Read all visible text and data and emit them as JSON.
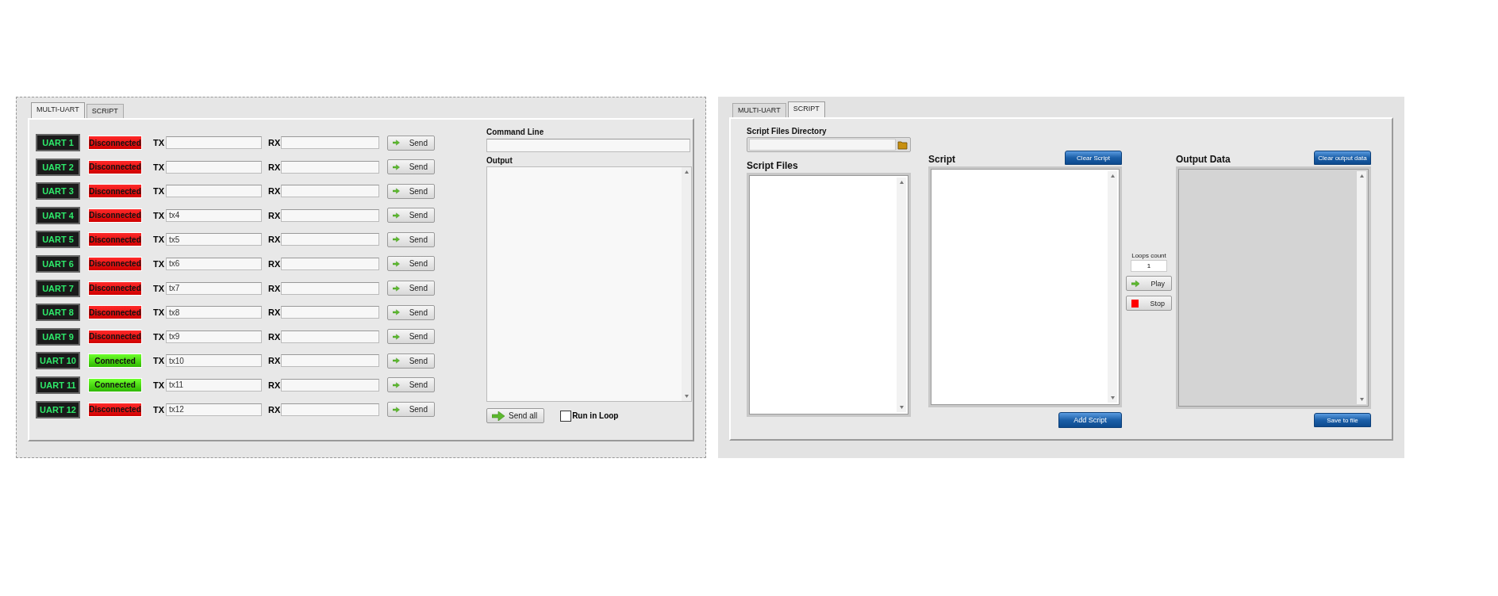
{
  "multi_uart": {
    "tabs": [
      {
        "label": "MULTI-UART",
        "selected": true
      },
      {
        "label": "SCRIPT",
        "selected": false
      }
    ],
    "channels": [
      {
        "name": "UART 1",
        "status": "Disconnected",
        "connected": false,
        "tx_label": "TX",
        "rx_label": "RX",
        "send": "Send"
      },
      {
        "name": "UART 2",
        "status": "Disconnected",
        "connected": false,
        "tx_label": "TX",
        "rx_label": "RX",
        "send": "Send"
      },
      {
        "name": "UART 3",
        "status": "Disconnected",
        "connected": false,
        "tx_label": "TX",
        "rx_label": "RX",
        "send": "Send"
      },
      {
        "name": "UART 4",
        "status": "Disconnected",
        "connected": false,
        "tx_label": "TX",
        "tx": "tx4",
        "rx_label": "RX",
        "send": "Send"
      },
      {
        "name": "UART 5",
        "status": "Disconnected",
        "connected": false,
        "tx_label": "TX",
        "tx": "tx5",
        "rx_label": "RX",
        "send": "Send"
      },
      {
        "name": "UART 6",
        "status": "Disconnected",
        "connected": false,
        "tx_label": "TX",
        "tx": "tx6",
        "rx_label": "RX",
        "send": "Send"
      },
      {
        "name": "UART 7",
        "status": "Disconnected",
        "connected": false,
        "tx_label": "TX",
        "tx": "tx7",
        "rx_label": "RX",
        "send": "Send"
      },
      {
        "name": "UART 8",
        "status": "Disconnected",
        "connected": false,
        "tx_label": "TX",
        "tx": "tx8",
        "rx_label": "RX",
        "send": "Send"
      },
      {
        "name": "UART 9",
        "status": "Disconnected",
        "connected": false,
        "tx_label": "TX",
        "tx": "tx9",
        "rx_label": "RX",
        "send": "Send"
      },
      {
        "name": "UART 10",
        "status": "Connected",
        "connected": true,
        "tx_label": "TX",
        "tx": "tx10",
        "rx_label": "RX",
        "send": "Send"
      },
      {
        "name": "UART 11",
        "status": "Connected",
        "connected": true,
        "tx_label": "TX",
        "tx": "tx11",
        "rx_label": "RX",
        "send": "Send"
      },
      {
        "name": "UART 12",
        "status": "Disconnected",
        "connected": false,
        "tx_label": "TX",
        "tx": "tx12",
        "rx_label": "RX",
        "send": "Send"
      }
    ],
    "command_line": {
      "label": "Command Line"
    },
    "output": {
      "label": "Output"
    },
    "send_all": "Send all",
    "run_in_loop": {
      "label": "Run in Loop",
      "checked": false
    }
  },
  "script": {
    "tabs": [
      {
        "label": "MULTI-UART",
        "selected": false
      },
      {
        "label": "SCRIPT",
        "selected": true
      }
    ],
    "directory": {
      "label": "Script Files Directory"
    },
    "script_files": {
      "label": "Script Files"
    },
    "script": {
      "label": "Script",
      "clear_button": "Clear Script",
      "add_button": "Add Script"
    },
    "loops": {
      "label": "Loops count",
      "value": "1"
    },
    "play": "Play",
    "stop": "Stop",
    "output_data": {
      "label": "Output Data",
      "clear_button": "Clear output data",
      "save_button": "Save to file"
    }
  }
}
